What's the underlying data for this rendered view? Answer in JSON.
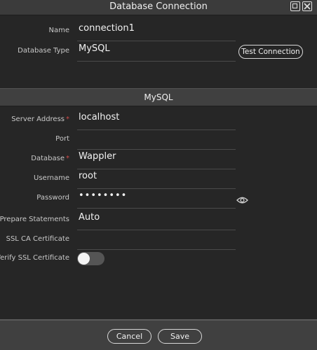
{
  "window": {
    "title": "Database Connection"
  },
  "connection": {
    "name_label": "Name",
    "name_value": "connection1",
    "type_label": "Database Type",
    "type_value": "MySQL",
    "test_button": "Test Connection"
  },
  "section": {
    "title": "MySQL"
  },
  "fields": {
    "server_label": "Server Address",
    "server_value": "localhost",
    "port_label": "Port",
    "port_value": "",
    "database_label": "Database",
    "database_value": "Wappler",
    "username_label": "Username",
    "username_value": "root",
    "password_label": "Password",
    "password_value": "••••••••",
    "prepare_label": "Prepare Statements",
    "prepare_value": "Auto",
    "ssl_ca_label": "SSL CA Certificate",
    "ssl_ca_value": "",
    "verify_ssl_label": "Verify SSL Certificate",
    "verify_ssl_on": false
  },
  "required_marker": "*",
  "footer": {
    "cancel": "Cancel",
    "save": "Save"
  },
  "icons": {
    "maximize": "maximize-icon",
    "close": "close-icon",
    "password_reveal": "eye-icon"
  }
}
